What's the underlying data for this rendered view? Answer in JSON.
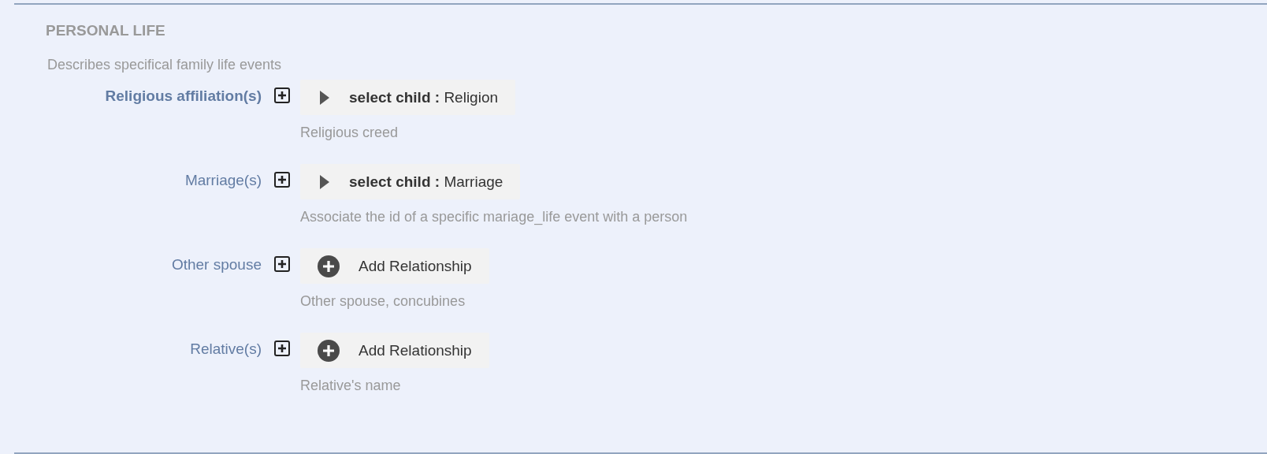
{
  "section": {
    "title": "PERSONAL LIFE",
    "description": "Describes specifical family life events"
  },
  "fields": [
    {
      "label": "Religious affiliation(s)",
      "required": true,
      "kind": "select",
      "button": "**select child :** Religion",
      "help": "Religious creed"
    },
    {
      "label": "Marriage(s)",
      "required": false,
      "kind": "select",
      "button": "**select child :** Marriage",
      "help": "Associate the id of a specific mariage_life event with a person"
    },
    {
      "label": "Other spouse",
      "required": false,
      "kind": "add",
      "button": "Add Relationship",
      "help": "Other spouse, concubines"
    },
    {
      "label": "Relative(s)",
      "required": false,
      "kind": "add",
      "button": "Add Relationship",
      "help": "Relative's name"
    }
  ]
}
